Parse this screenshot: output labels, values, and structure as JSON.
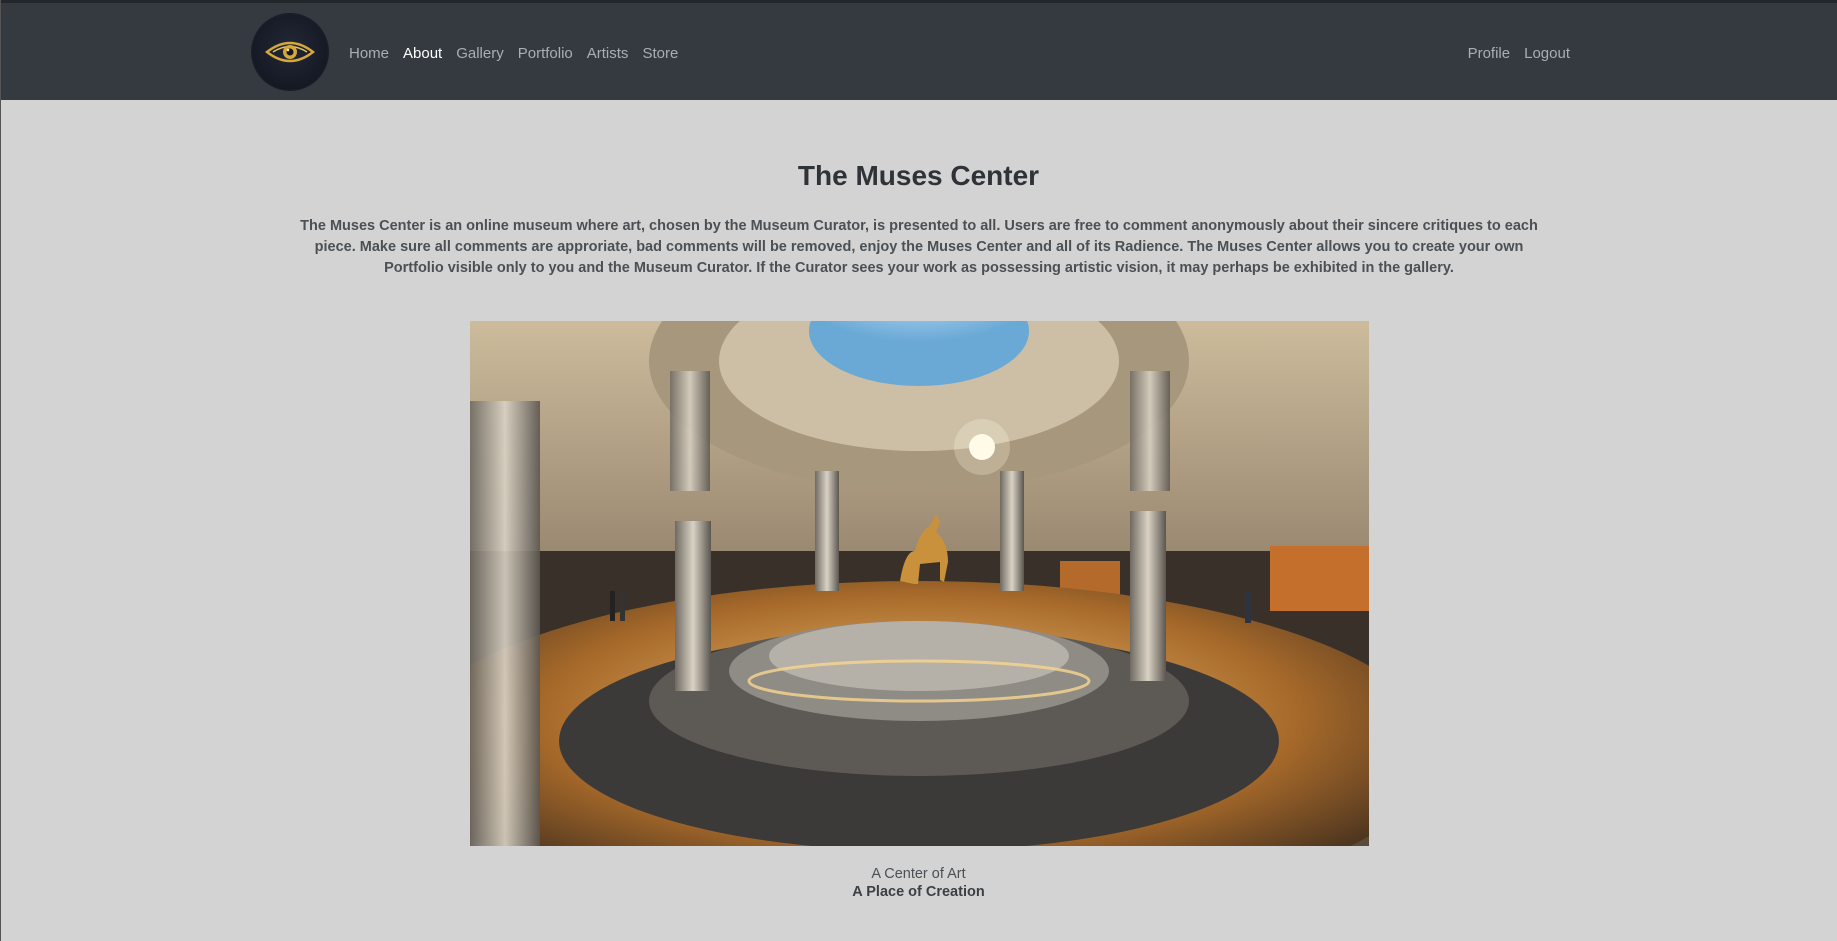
{
  "nav": {
    "logo_icon": "eye-icon",
    "left_items": [
      {
        "label": "Home",
        "active": false
      },
      {
        "label": "About",
        "active": true
      },
      {
        "label": "Gallery",
        "active": false
      },
      {
        "label": "Portfolio",
        "active": false
      },
      {
        "label": "Artists",
        "active": false
      },
      {
        "label": "Store",
        "active": false
      }
    ],
    "right_items": [
      {
        "label": "Profile"
      },
      {
        "label": "Logout"
      }
    ]
  },
  "main": {
    "title": "The Muses Center",
    "intro": "The Muses Center is an online museum where art, chosen by the Museum Curator, is presented to all. Users are free to comment anonymously about their sincere critiques to each piece. Make sure all comments are approriate, bad comments will be removed, enjoy the Muses Center and all of its Radience. The Muses Center allows you to create your own Portfolio visible only to you and the Museum Curator. If the Curator sees your work as possessing artistic vision, it may perhaps be exhibited in the gallery.",
    "caption_line1": "A Center of Art",
    "caption_line2": "A Place of Creation"
  },
  "colors": {
    "navbar": "#343a40",
    "page_bg": "#d3d3d3",
    "nav_link": "#a9aeb2",
    "nav_active": "#ffffff",
    "logo_gold": "#d4a83a"
  }
}
